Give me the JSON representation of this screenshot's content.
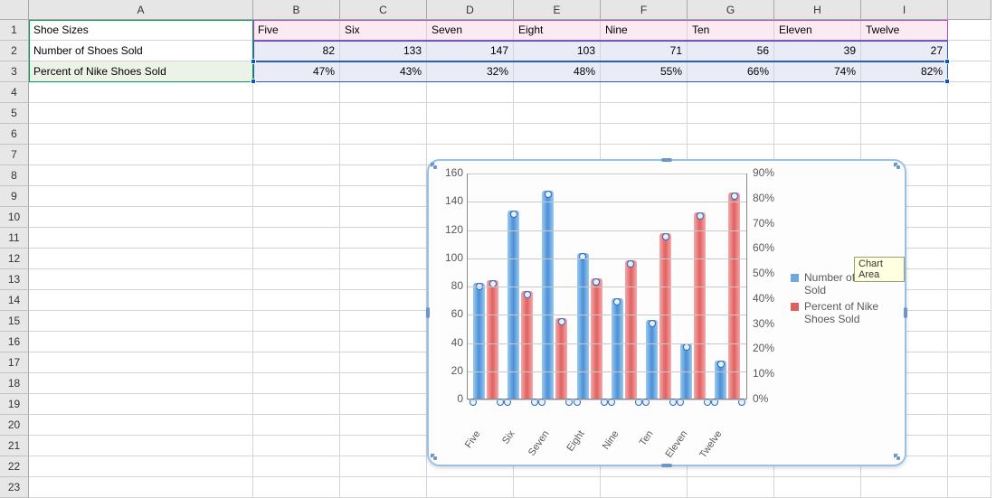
{
  "columns": [
    "A",
    "B",
    "C",
    "D",
    "E",
    "F",
    "G",
    "H",
    "I"
  ],
  "row_numbers": [
    1,
    2,
    3,
    4,
    5,
    6,
    7,
    8,
    9,
    10,
    11,
    12,
    13,
    14,
    15,
    16,
    17,
    18,
    19,
    20,
    21,
    22,
    23
  ],
  "table": {
    "headers_row_label": "Shoe Sizes",
    "series1_label": "Number of Shoes Sold",
    "series2_label": "Percent of Nike Shoes Sold",
    "categories": [
      "Five",
      "Six",
      "Seven",
      "Eight",
      "Nine",
      "Ten",
      "Eleven",
      "Twelve"
    ],
    "series1": [
      82,
      133,
      147,
      103,
      71,
      56,
      39,
      27
    ],
    "series2_display": [
      "47%",
      "43%",
      "32%",
      "48%",
      "55%",
      "66%",
      "74%",
      "82%"
    ]
  },
  "tooltip": "Chart Area",
  "legend_labels": [
    "Number of Shoes Sold",
    "Percent of Nike Shoes Sold"
  ],
  "chart_data": {
    "type": "bar",
    "categories": [
      "Five",
      "Six",
      "Seven",
      "Eight",
      "Nine",
      "Ten",
      "Eleven",
      "Twelve"
    ],
    "series": [
      {
        "name": "Number of Shoes Sold",
        "axis": "left",
        "values": [
          82,
          133,
          147,
          103,
          71,
          56,
          39,
          27
        ]
      },
      {
        "name": "Percent of Nike Shoes Sold",
        "axis": "right",
        "values": [
          0.47,
          0.43,
          0.32,
          0.48,
          0.55,
          0.66,
          0.74,
          0.82
        ]
      }
    ],
    "left_axis": {
      "min": 0,
      "max": 160,
      "step": 20,
      "ticks": [
        0,
        20,
        40,
        60,
        80,
        100,
        120,
        140,
        160
      ]
    },
    "right_axis": {
      "min": 0,
      "max": 0.9,
      "step": 0.1,
      "tick_labels": [
        "0%",
        "10%",
        "20%",
        "30%",
        "40%",
        "50%",
        "60%",
        "70%",
        "80%",
        "90%"
      ]
    },
    "title": "",
    "xlabel": "",
    "ylabel": "",
    "legend_position": "right",
    "grid": true
  }
}
